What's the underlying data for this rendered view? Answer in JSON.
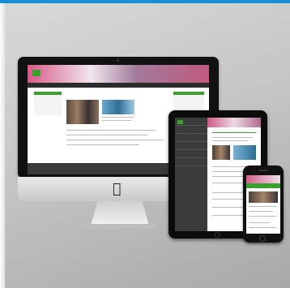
{
  "brand": {
    "accent": "#1a8fd6",
    "green": "#3aa02e"
  },
  "site": {
    "logo_text": "",
    "site_name": "",
    "nav_items": [
      "",
      "",
      "",
      "",
      ""
    ],
    "headline": "",
    "footer_left": "",
    "footer_right": ""
  },
  "ipad": {
    "menu_items": [
      "",
      "",
      "",
      "",
      "",
      ""
    ]
  },
  "icons": [
    "apple-logo-icon"
  ]
}
